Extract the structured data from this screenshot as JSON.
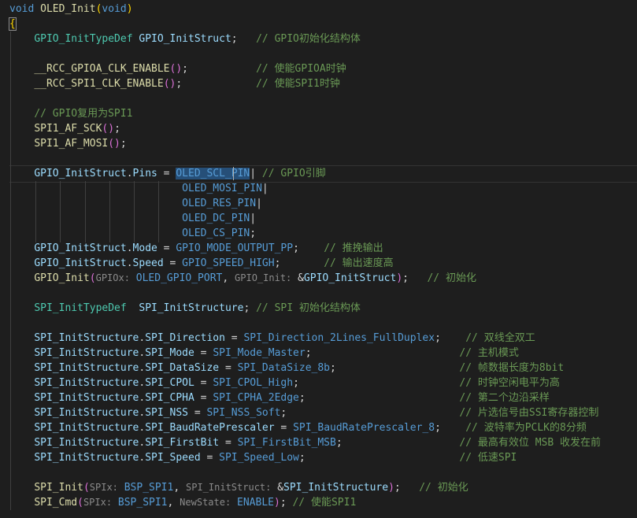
{
  "lines": [
    [
      [
        "void",
        "kw"
      ],
      [
        " ",
        "pn"
      ],
      [
        "OLED_Init",
        "fn"
      ],
      [
        "(",
        "br"
      ],
      [
        "void",
        "kw"
      ],
      [
        ")",
        "br"
      ]
    ],
    [
      [
        "{",
        "br"
      ]
    ],
    [
      [
        "    ",
        "pn"
      ],
      [
        "GPIO_InitTypeDef",
        "ty"
      ],
      [
        " ",
        "pn"
      ],
      [
        "GPIO_InitStruct",
        "var"
      ],
      [
        ";",
        "pn"
      ],
      [
        "   ",
        "pn"
      ],
      [
        "// GPIO初始化结构体",
        "cm"
      ]
    ],
    [],
    [
      [
        "    ",
        "pn"
      ],
      [
        "__RCC_GPIOA_CLK_ENABLE",
        "fn"
      ],
      [
        "()",
        "br2"
      ],
      [
        ";",
        "pn"
      ],
      [
        "           ",
        "pn"
      ],
      [
        "// 使能GPIOA时钟",
        "cm"
      ]
    ],
    [
      [
        "    ",
        "pn"
      ],
      [
        "__RCC_SPI1_CLK_ENABLE",
        "fn"
      ],
      [
        "()",
        "br2"
      ],
      [
        ";",
        "pn"
      ],
      [
        "            ",
        "pn"
      ],
      [
        "// 使能SPI1时钟",
        "cm"
      ]
    ],
    [],
    [
      [
        "    ",
        "pn"
      ],
      [
        "// GPIO复用为SPI1",
        "cm"
      ]
    ],
    [
      [
        "    ",
        "pn"
      ],
      [
        "SPI1_AF_SCK",
        "fn"
      ],
      [
        "()",
        "br2"
      ],
      [
        ";",
        "pn"
      ]
    ],
    [
      [
        "    ",
        "pn"
      ],
      [
        "SPI1_AF_MOSI",
        "fn"
      ],
      [
        "()",
        "br2"
      ],
      [
        ";",
        "pn"
      ]
    ],
    [],
    [
      [
        "    ",
        "pn"
      ],
      [
        "GPIO_InitStruct",
        "var"
      ],
      [
        ".",
        "pn"
      ],
      [
        "Pins",
        "var"
      ],
      [
        " = ",
        "pn"
      ],
      [
        "OLED_SCL_PIN",
        "mac"
      ],
      [
        "| ",
        "pn"
      ],
      [
        "// GPIO引脚",
        "cm"
      ]
    ],
    [
      [
        "                            ",
        "pn"
      ],
      [
        "OLED_MOSI_PIN",
        "mac"
      ],
      [
        "|",
        "pn"
      ]
    ],
    [
      [
        "                            ",
        "pn"
      ],
      [
        "OLED_RES_PIN",
        "mac"
      ],
      [
        "|",
        "pn"
      ]
    ],
    [
      [
        "                            ",
        "pn"
      ],
      [
        "OLED_DC_PIN",
        "mac"
      ],
      [
        "|",
        "pn"
      ]
    ],
    [
      [
        "                            ",
        "pn"
      ],
      [
        "OLED_CS_PIN",
        "mac"
      ],
      [
        ";",
        "pn"
      ]
    ],
    [
      [
        "    ",
        "pn"
      ],
      [
        "GPIO_InitStruct",
        "var"
      ],
      [
        ".",
        "pn"
      ],
      [
        "Mode",
        "var"
      ],
      [
        " = ",
        "pn"
      ],
      [
        "GPIO_MODE_OUTPUT_PP",
        "mac"
      ],
      [
        ";",
        "pn"
      ],
      [
        "    ",
        "pn"
      ],
      [
        "// 推挽输出",
        "cm"
      ]
    ],
    [
      [
        "    ",
        "pn"
      ],
      [
        "GPIO_InitStruct",
        "var"
      ],
      [
        ".",
        "pn"
      ],
      [
        "Speed",
        "var"
      ],
      [
        " = ",
        "pn"
      ],
      [
        "GPIO_SPEED_HIGH",
        "mac"
      ],
      [
        ";",
        "pn"
      ],
      [
        "       ",
        "pn"
      ],
      [
        "// 输出速度高",
        "cm"
      ]
    ],
    [
      [
        "    ",
        "pn"
      ],
      [
        "GPIO_Init",
        "fn"
      ],
      [
        "(",
        "br2"
      ],
      [
        "GPIOx:",
        "hint"
      ],
      [
        " ",
        "pn"
      ],
      [
        "OLED_GPIO_PORT",
        "mac"
      ],
      [
        ", ",
        "pn"
      ],
      [
        "GPIO_Init:",
        "hint"
      ],
      [
        " &",
        "pn"
      ],
      [
        "GPIO_InitStruct",
        "var"
      ],
      [
        ")",
        "br2"
      ],
      [
        ";",
        "pn"
      ],
      [
        "   ",
        "pn"
      ],
      [
        "// 初始化",
        "cm"
      ]
    ],
    [],
    [
      [
        "    ",
        "pn"
      ],
      [
        "SPI_InitTypeDef",
        "ty"
      ],
      [
        "  ",
        "pn"
      ],
      [
        "SPI_InitStructure",
        "var"
      ],
      [
        ";",
        "pn"
      ],
      [
        " ",
        "pn"
      ],
      [
        "// SPI 初始化结构体",
        "cm"
      ]
    ],
    [],
    [
      [
        "    ",
        "pn"
      ],
      [
        "SPI_InitStructure",
        "var"
      ],
      [
        ".",
        "pn"
      ],
      [
        "SPI_Direction",
        "var"
      ],
      [
        " = ",
        "pn"
      ],
      [
        "SPI_Direction_2Lines_FullDuplex",
        "mac"
      ],
      [
        ";",
        "pn"
      ],
      [
        "    ",
        "pn"
      ],
      [
        "// 双线全双工",
        "cm"
      ]
    ],
    [
      [
        "    ",
        "pn"
      ],
      [
        "SPI_InitStructure",
        "var"
      ],
      [
        ".",
        "pn"
      ],
      [
        "SPI_Mode",
        "var"
      ],
      [
        " = ",
        "pn"
      ],
      [
        "SPI_Mode_Master",
        "mac"
      ],
      [
        ";",
        "pn"
      ],
      [
        "                        ",
        "pn"
      ],
      [
        "// 主机模式",
        "cm"
      ]
    ],
    [
      [
        "    ",
        "pn"
      ],
      [
        "SPI_InitStructure",
        "var"
      ],
      [
        ".",
        "pn"
      ],
      [
        "SPI_DataSize",
        "var"
      ],
      [
        " = ",
        "pn"
      ],
      [
        "SPI_DataSize_8b",
        "mac"
      ],
      [
        ";",
        "pn"
      ],
      [
        "                    ",
        "pn"
      ],
      [
        "// 帧数据长度为8bit",
        "cm"
      ]
    ],
    [
      [
        "    ",
        "pn"
      ],
      [
        "SPI_InitStructure",
        "var"
      ],
      [
        ".",
        "pn"
      ],
      [
        "SPI_CPOL",
        "var"
      ],
      [
        " = ",
        "pn"
      ],
      [
        "SPI_CPOL_High",
        "mac"
      ],
      [
        ";",
        "pn"
      ],
      [
        "                          ",
        "pn"
      ],
      [
        "// 时钟空闲电平为高",
        "cm"
      ]
    ],
    [
      [
        "    ",
        "pn"
      ],
      [
        "SPI_InitStructure",
        "var"
      ],
      [
        ".",
        "pn"
      ],
      [
        "SPI_CPHA",
        "var"
      ],
      [
        " = ",
        "pn"
      ],
      [
        "SPI_CPHA_2Edge",
        "mac"
      ],
      [
        ";",
        "pn"
      ],
      [
        "                         ",
        "pn"
      ],
      [
        "// 第二个边沿采样",
        "cm"
      ]
    ],
    [
      [
        "    ",
        "pn"
      ],
      [
        "SPI_InitStructure",
        "var"
      ],
      [
        ".",
        "pn"
      ],
      [
        "SPI_NSS",
        "var"
      ],
      [
        " = ",
        "pn"
      ],
      [
        "SPI_NSS_Soft",
        "mac"
      ],
      [
        ";",
        "pn"
      ],
      [
        "                            ",
        "pn"
      ],
      [
        "// 片选信号由SSI寄存器控制",
        "cm"
      ]
    ],
    [
      [
        "    ",
        "pn"
      ],
      [
        "SPI_InitStructure",
        "var"
      ],
      [
        ".",
        "pn"
      ],
      [
        "SPI_BaudRatePrescaler",
        "var"
      ],
      [
        " = ",
        "pn"
      ],
      [
        "SPI_BaudRatePrescaler_8",
        "mac"
      ],
      [
        ";",
        "pn"
      ],
      [
        "    ",
        "pn"
      ],
      [
        "// 波特率为PCLK的8分频",
        "cm"
      ]
    ],
    [
      [
        "    ",
        "pn"
      ],
      [
        "SPI_InitStructure",
        "var"
      ],
      [
        ".",
        "pn"
      ],
      [
        "SPI_FirstBit",
        "var"
      ],
      [
        " = ",
        "pn"
      ],
      [
        "SPI_FirstBit_MSB",
        "mac"
      ],
      [
        ";",
        "pn"
      ],
      [
        "                   ",
        "pn"
      ],
      [
        "// 最高有效位 MSB 收发在前",
        "cm"
      ]
    ],
    [
      [
        "    ",
        "pn"
      ],
      [
        "SPI_InitStructure",
        "var"
      ],
      [
        ".",
        "pn"
      ],
      [
        "SPI_Speed",
        "var"
      ],
      [
        " = ",
        "pn"
      ],
      [
        "SPI_Speed_Low",
        "mac"
      ],
      [
        ";",
        "pn"
      ],
      [
        "                         ",
        "pn"
      ],
      [
        "// 低速SPI",
        "cm"
      ]
    ],
    [],
    [
      [
        "    ",
        "pn"
      ],
      [
        "SPI_Init",
        "fn"
      ],
      [
        "(",
        "br2"
      ],
      [
        "SPIx:",
        "hint"
      ],
      [
        " ",
        "pn"
      ],
      [
        "BSP_SPI1",
        "mac"
      ],
      [
        ", ",
        "pn"
      ],
      [
        "SPI_InitStruct:",
        "hint"
      ],
      [
        " &",
        "pn"
      ],
      [
        "SPI_InitStructure",
        "var"
      ],
      [
        ")",
        "br2"
      ],
      [
        ";",
        "pn"
      ],
      [
        "   ",
        "pn"
      ],
      [
        "// 初始化",
        "cm"
      ]
    ],
    [
      [
        "    ",
        "pn"
      ],
      [
        "SPI_Cmd",
        "fn"
      ],
      [
        "(",
        "br2"
      ],
      [
        "SPIx:",
        "hint"
      ],
      [
        " ",
        "pn"
      ],
      [
        "BSP_SPI1",
        "mac"
      ],
      [
        ", ",
        "pn"
      ],
      [
        "NewState:",
        "hint"
      ],
      [
        " ",
        "pn"
      ],
      [
        "ENABLE",
        "mac"
      ],
      [
        ")",
        "br2"
      ],
      [
        ";",
        "pn"
      ],
      [
        " ",
        "pn"
      ],
      [
        "// 使能SPI1",
        "cm"
      ]
    ]
  ]
}
